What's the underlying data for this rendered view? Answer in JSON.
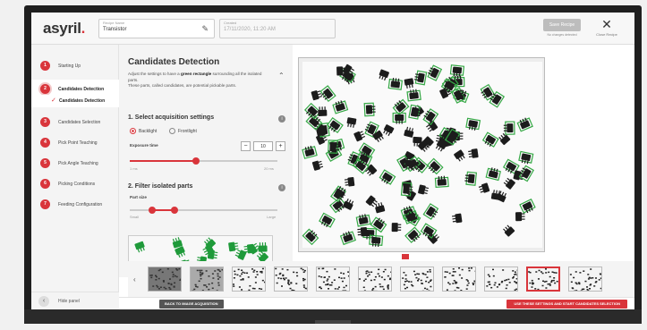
{
  "app": {
    "logo": "asyril",
    "logo_dot": "."
  },
  "header": {
    "recipe_label": "Recipe Name",
    "recipe_value": "Transistor",
    "created_label": "Created",
    "created_value": "17/11/2020, 11:20 AM",
    "save_label": "Save Recipe",
    "no_changes": "No changes detected",
    "close_label": "Close Recipe"
  },
  "sidebar": {
    "steps": [
      {
        "num": "1",
        "label": "Starting Up"
      },
      {
        "num": "2",
        "label": "Candidates Detection"
      },
      {
        "num": "3",
        "label": "Candidates Selection"
      },
      {
        "num": "4",
        "label": "Pick Point Teaching"
      },
      {
        "num": "5",
        "label": "Pick Angle Teaching"
      },
      {
        "num": "6",
        "label": "Picking Conditions"
      },
      {
        "num": "7",
        "label": "Feeding Configuration"
      }
    ],
    "substep": "Candidates Detection",
    "hide_panel": "Hide panel"
  },
  "panel": {
    "title": "Candidates Detection",
    "desc_pre": "Adjust the settings to have a ",
    "desc_bold": "green rectangle",
    "desc_post": " surrounding all the isolated parts.",
    "desc_line2": "These parts, called candidates, are potential pickable parts.",
    "section1": "1. Select acquisition settings",
    "radio1": "Backlight",
    "radio2": "Frontlight",
    "exposure_label": "Exposure time",
    "exposure_value": "10",
    "exp_min": "1 ms",
    "exp_max": "20 ms",
    "section2": "2. Filter isolated parts",
    "part_size": "Part size",
    "size_min": "Small",
    "size_max": "Large"
  },
  "sliders": {
    "exposure_fraction": 0.45,
    "size_low": 0.15,
    "size_high": 0.3
  },
  "footer": {
    "back": "BACK TO IMAGE ACQUISITION",
    "use": "USE THESE SETTINGS AND START CANDIDATES SELECTION"
  },
  "colors": {
    "accent": "#d9353b",
    "detect": "#35a845"
  }
}
